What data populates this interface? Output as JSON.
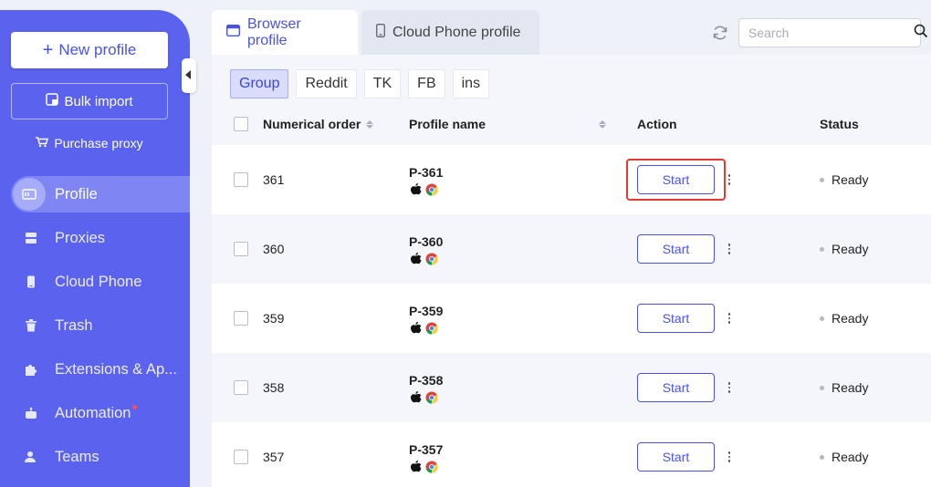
{
  "sidebar": {
    "new_profile": "New profile",
    "bulk_import": "Bulk import",
    "purchase_proxy": "Purchase proxy",
    "items": [
      {
        "label": "Profile",
        "icon": "profile-card-icon",
        "active": true
      },
      {
        "label": "Proxies",
        "icon": "server-icon",
        "active": false
      },
      {
        "label": "Cloud Phone",
        "icon": "phone-icon",
        "active": false
      },
      {
        "label": "Trash",
        "icon": "trash-icon",
        "active": false
      },
      {
        "label": "Extensions & Ap...",
        "icon": "puzzle-icon",
        "active": false
      },
      {
        "label": "Automation",
        "icon": "robot-icon",
        "active": false,
        "badge_dot": true
      },
      {
        "label": "Teams",
        "icon": "users-icon",
        "active": false
      }
    ]
  },
  "tabs": {
    "browser": "Browser profile",
    "cloud": "Cloud Phone profile"
  },
  "search": {
    "placeholder": "Search"
  },
  "groups": [
    {
      "label": "Group",
      "active": true
    },
    {
      "label": "Reddit",
      "active": false
    },
    {
      "label": "TK",
      "active": false
    },
    {
      "label": "FB",
      "active": false
    },
    {
      "label": "ins",
      "active": false
    }
  ],
  "table": {
    "columns": {
      "order": "Numerical order",
      "name": "Profile name",
      "action": "Action",
      "status": "Status"
    },
    "rows": [
      {
        "order": "361",
        "name": "P-361",
        "action": "Start",
        "status": "Ready"
      },
      {
        "order": "360",
        "name": "P-360",
        "action": "Start",
        "status": "Ready"
      },
      {
        "order": "359",
        "name": "P-359",
        "action": "Start",
        "status": "Ready"
      },
      {
        "order": "358",
        "name": "P-358",
        "action": "Start",
        "status": "Ready"
      },
      {
        "order": "357",
        "name": "P-357",
        "action": "Start",
        "status": "Ready"
      }
    ]
  },
  "colors": {
    "sidebar": "#5b63ee",
    "accent": "#4a52e6",
    "highlight": "#e53935"
  }
}
